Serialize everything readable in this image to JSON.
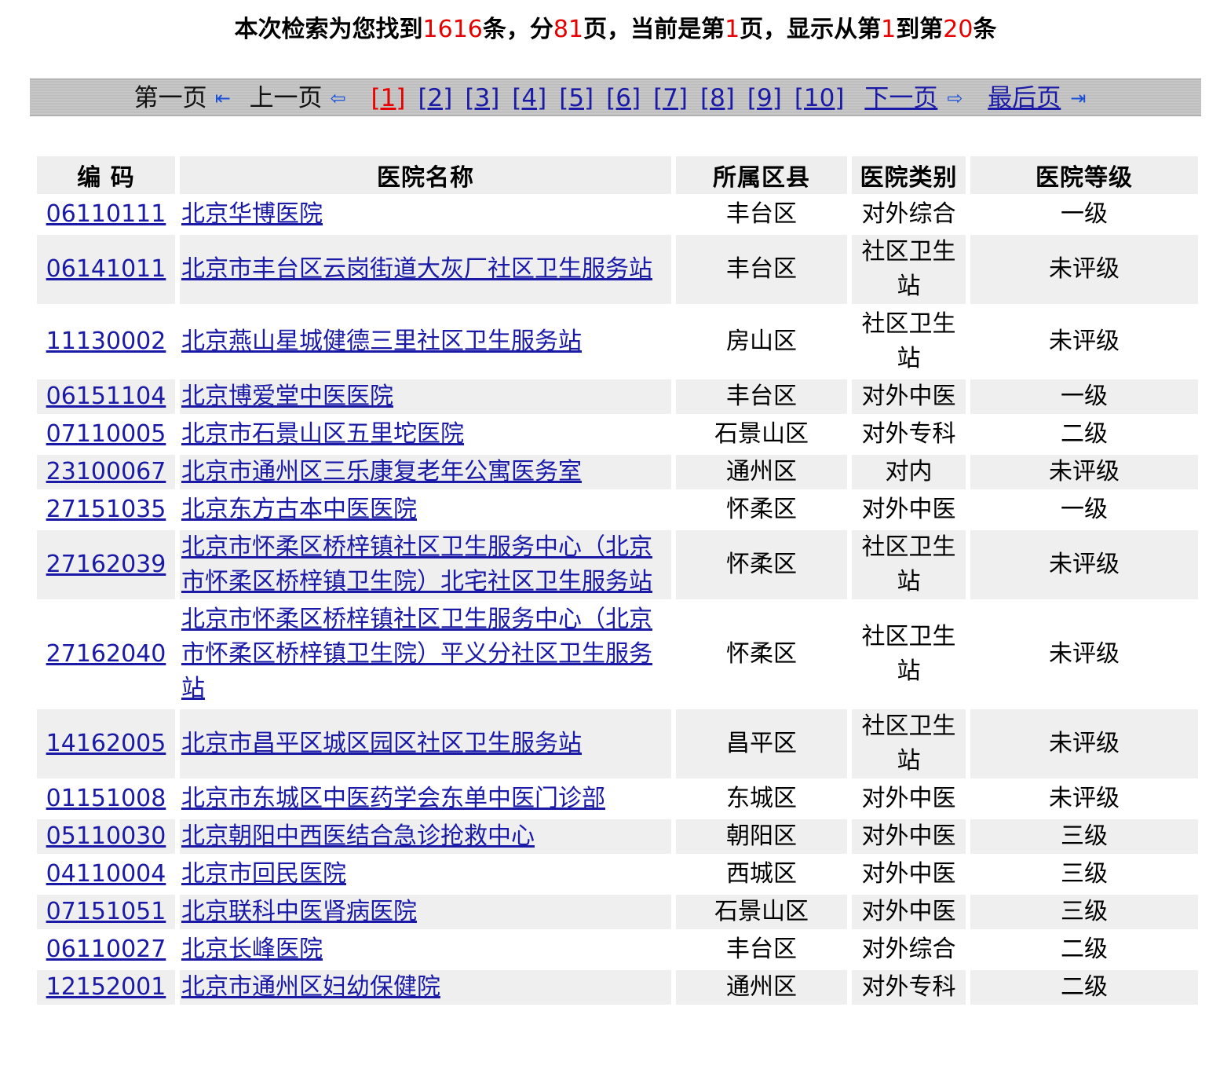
{
  "summary": {
    "t1": "本次检索为您找到",
    "total": "1616",
    "t2": "条，分",
    "pages": "81",
    "t3": "页，当前是第",
    "current": "1",
    "t4": "页，显示从第",
    "from": "1",
    "t5": "到第",
    "to": "20",
    "t6": "条"
  },
  "pager": {
    "first": "第一页",
    "prev": "上一页",
    "pages": [
      "[1]",
      "[2]",
      "[3]",
      "[4]",
      "[5]",
      "[6]",
      "[7]",
      "[8]",
      "[9]",
      "[10]"
    ],
    "next": "下一页",
    "last": "最后页"
  },
  "table": {
    "headers": [
      "编 码",
      "医院名称",
      "所属区县",
      "医院类别",
      "医院等级"
    ],
    "rows": [
      {
        "code": "06110111",
        "name": "北京华博医院",
        "district": "丰台区",
        "category": "对外综合",
        "level": "一级"
      },
      {
        "code": "06141011",
        "name": "北京市丰台区云岗街道大灰厂社区卫生服务站",
        "district": "丰台区",
        "category": "社区卫生站",
        "level": "未评级"
      },
      {
        "code": "11130002",
        "name": "北京燕山星城健德三里社区卫生服务站",
        "district": "房山区",
        "category": "社区卫生站",
        "level": "未评级"
      },
      {
        "code": "06151104",
        "name": "北京博爱堂中医医院",
        "district": "丰台区",
        "category": "对外中医",
        "level": "一级"
      },
      {
        "code": "07110005",
        "name": "北京市石景山区五里坨医院",
        "district": "石景山区",
        "category": "对外专科",
        "level": "二级"
      },
      {
        "code": "23100067",
        "name": "北京市通州区三乐康复老年公寓医务室",
        "district": "通州区",
        "category": "对内",
        "level": "未评级"
      },
      {
        "code": "27151035",
        "name": "北京东方古本中医医院",
        "district": "怀柔区",
        "category": "对外中医",
        "level": "一级"
      },
      {
        "code": "27162039",
        "name": "北京市怀柔区桥梓镇社区卫生服务中心（北京市怀柔区桥梓镇卫生院）北宅社区卫生服务站",
        "district": "怀柔区",
        "category": "社区卫生站",
        "level": "未评级"
      },
      {
        "code": "27162040",
        "name": "北京市怀柔区桥梓镇社区卫生服务中心（北京市怀柔区桥梓镇卫生院）平义分社区卫生服务站",
        "district": "怀柔区",
        "category": "社区卫生站",
        "level": "未评级"
      },
      {
        "code": "14162005",
        "name": "北京市昌平区城区园区社区卫生服务站",
        "district": "昌平区",
        "category": "社区卫生站",
        "level": "未评级"
      },
      {
        "code": "01151008",
        "name": "北京市东城区中医药学会东单中医门诊部",
        "district": "东城区",
        "category": "对外中医",
        "level": "未评级"
      },
      {
        "code": "05110030",
        "name": "北京朝阳中西医结合急诊抢救中心",
        "district": "朝阳区",
        "category": "对外中医",
        "level": "三级"
      },
      {
        "code": "04110004",
        "name": "北京市回民医院",
        "district": "西城区",
        "category": "对外中医",
        "level": "三级"
      },
      {
        "code": "07151051",
        "name": "北京联科中医肾病医院",
        "district": "石景山区",
        "category": "对外中医",
        "level": "三级"
      },
      {
        "code": "06110027",
        "name": "北京长峰医院",
        "district": "丰台区",
        "category": "对外综合",
        "level": "二级"
      },
      {
        "code": "12152001",
        "name": "北京市通州区妇幼保健院",
        "district": "通州区",
        "category": "对外专科",
        "level": "二级"
      }
    ]
  }
}
